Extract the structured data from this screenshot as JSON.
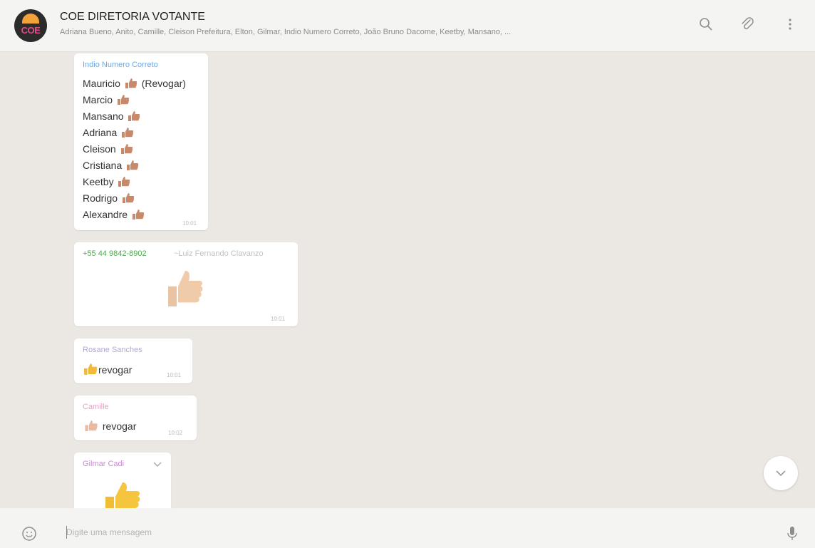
{
  "header": {
    "avatar_text": "COE",
    "title": "COE DIRETORIA VOTANTE",
    "members": "Adriana Bueno, Anito, Camille, Cleison Prefeitura, Elton, Gilmar, Indio Numero Correto, João Bruno Dacome, Keetby, Mansano, ..."
  },
  "messages": [
    {
      "sender": "Indio Numero Correto",
      "sender_color": "#6aa9ea",
      "lines": [
        "Mauricio",
        "Marcio",
        "Mansano",
        "Adriana",
        "Cleison",
        "Cristiana",
        "Keetby",
        "Rodrigo",
        "Alexandre"
      ],
      "first_line_suffix": "(Revogar)",
      "time": "10:01"
    },
    {
      "sender": "+55 44 9842-8902",
      "sender_color": "#4fa84f",
      "sender_name": "~Luiz Fernando Clavanzo",
      "time": "10:01"
    },
    {
      "sender": "Rosane Sanches",
      "sender_color": "#b6a7d6",
      "text": "revogar",
      "time": "10:01"
    },
    {
      "sender": "Camille",
      "sender_color": "#e7a3c9",
      "text": "revogar",
      "time": "10:02"
    },
    {
      "sender": "Gilmar Cadi",
      "sender_color": "#c88ad1"
    }
  ],
  "composer": {
    "placeholder": "Digite uma mensagem"
  },
  "icons": {
    "search": "search-icon",
    "attach": "paperclip-icon",
    "menu": "menu-icon",
    "emoji": "emoji-icon",
    "mic": "mic-icon",
    "scroll": "chevron-down-icon"
  }
}
